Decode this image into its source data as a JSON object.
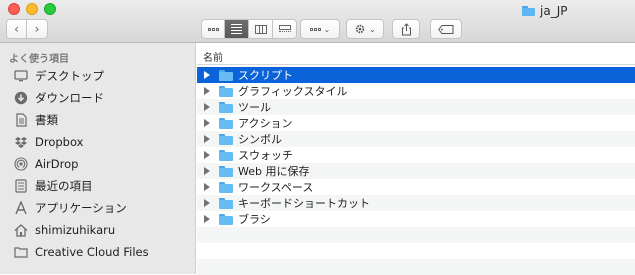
{
  "window": {
    "title": "ja_JP"
  },
  "toolbar": {
    "back_glyph": "‹",
    "forward_glyph": "›",
    "views": [
      "icons-view",
      "list-view",
      "columns-view",
      "gallery-view"
    ],
    "selected_view": "list-view",
    "group_icon": "group-by-icon",
    "action_icon": "gear-icon",
    "share_icon": "share-icon",
    "tags_icon": "tag-icon",
    "dropdown_glyph": "⌄"
  },
  "sidebar": {
    "heading": "よく使う項目",
    "items": [
      {
        "label": "デスクトップ",
        "icon": "desktop-icon"
      },
      {
        "label": "ダウンロード",
        "icon": "download-icon"
      },
      {
        "label": "書類",
        "icon": "documents-icon"
      },
      {
        "label": "Dropbox",
        "icon": "dropbox-icon"
      },
      {
        "label": "AirDrop",
        "icon": "airdrop-icon"
      },
      {
        "label": "最近の項目",
        "icon": "recents-icon"
      },
      {
        "label": "アプリケーション",
        "icon": "applications-icon"
      },
      {
        "label": "shimizuhikaru",
        "icon": "home-icon"
      },
      {
        "label": "Creative Cloud Files",
        "icon": "folder-icon"
      }
    ]
  },
  "list": {
    "column_header": "名前",
    "selected_index": 0,
    "rows": [
      {
        "name": "スクリプト"
      },
      {
        "name": "グラフィックスタイル"
      },
      {
        "name": "ツール"
      },
      {
        "name": "アクション"
      },
      {
        "name": "シンボル"
      },
      {
        "name": "スウォッチ"
      },
      {
        "name": "Web 用に保存"
      },
      {
        "name": "ワークスペース"
      },
      {
        "name": "キーボードショートカット"
      },
      {
        "name": "ブラシ"
      }
    ]
  }
}
